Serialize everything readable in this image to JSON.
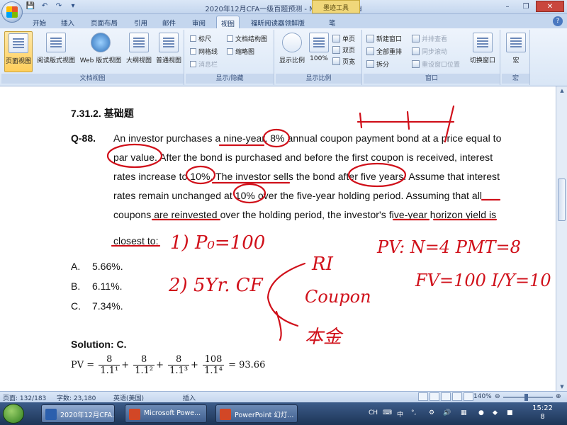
{
  "titlebar": {
    "title": "2020年12月CFA一级百题预测 - Microsoft Word",
    "context_tab": "墨迹工具",
    "qat": [
      "💾",
      "↶",
      "↷",
      "▾"
    ]
  },
  "tabs": [
    "开始",
    "插入",
    "页面布局",
    "引用",
    "邮件",
    "审阅",
    "视图",
    "福昕阅读器领鲜版",
    "笔"
  ],
  "active_tab": "视图",
  "ribbon": {
    "doc_views": {
      "label": "文档视图",
      "buttons": [
        "页面视图",
        "阅读版式视图",
        "Web 版式视图",
        "大纲视图",
        "普通视图"
      ]
    },
    "show_hide": {
      "label": "显示/隐藏",
      "items": [
        "标尺",
        "网格线",
        "消息栏",
        "文档结构图",
        "缩略图"
      ]
    },
    "zoom": {
      "label": "显示比例",
      "zoom_btn": "显示比例",
      "percent_btn": "100%",
      "items": [
        "单页",
        "双页",
        "页宽"
      ]
    },
    "window": {
      "label": "窗口",
      "items": [
        "新建窗口",
        "全部重排",
        "拆分"
      ],
      "disabled_items": [
        "并排查看",
        "同步滚动",
        "重设窗口位置"
      ],
      "switch_btn": "切换窗口"
    },
    "macro": {
      "label": "宏",
      "btn": "宏"
    }
  },
  "document": {
    "section_title": "7.31.2.  基础题",
    "question_id": "Q-88.",
    "question_lines": [
      "An investor purchases a nine-year, 8% annual coupon payment bond at a price equal to",
      "par value. After the bond is purchased and before the first coupon is received, interest",
      "rates increase to 10%. The investor sells the bond after five years. Assume that interest",
      "rates remain unchanged at 10% over the five-year holding period. Assuming that all",
      "coupons are reinvested over the holding period, the investor's five-year horizon yield is",
      "closest to:"
    ],
    "options": [
      {
        "letter": "A.",
        "value": "5.66%."
      },
      {
        "letter": "B.",
        "value": "6.11%."
      },
      {
        "letter": "C.",
        "value": "7.34%."
      }
    ],
    "solution": "Solution: C.",
    "formula": {
      "lhs": "PV =",
      "terms": [
        {
          "num": "8",
          "den": "1.1¹"
        },
        {
          "num": "8",
          "den": "1.1²"
        },
        {
          "num": "8",
          "den": "1.1³"
        },
        {
          "num": "108",
          "den": "1.1⁴"
        }
      ],
      "rhs": "= 93.66"
    }
  },
  "ink": {
    "note1": "1) P₀=100",
    "note2": "2) 5Yr. CF",
    "branch1": "RI",
    "branch2": "Coupon",
    "branch3": "本金",
    "calc1": "PV: N=4 PMT=8",
    "calc2": "FV=100 I/Y=10"
  },
  "statusbar": {
    "page": "页面: 132/183",
    "words": "字数: 23,180",
    "language": "英语(美国)",
    "mode": "插入",
    "zoom": "140%"
  },
  "taskbar": {
    "tasks": [
      "2020年12月CFA...",
      "Microsoft Powe...",
      "PowerPoint 幻灯..."
    ],
    "tray_lang": "CH",
    "tray_ime": "中",
    "time": "15:22",
    "date_line": "8"
  },
  "colors": {
    "ink": "#d0101a",
    "ribbon_bg": "#dbe7f7",
    "taskbar": "#1d3557"
  }
}
